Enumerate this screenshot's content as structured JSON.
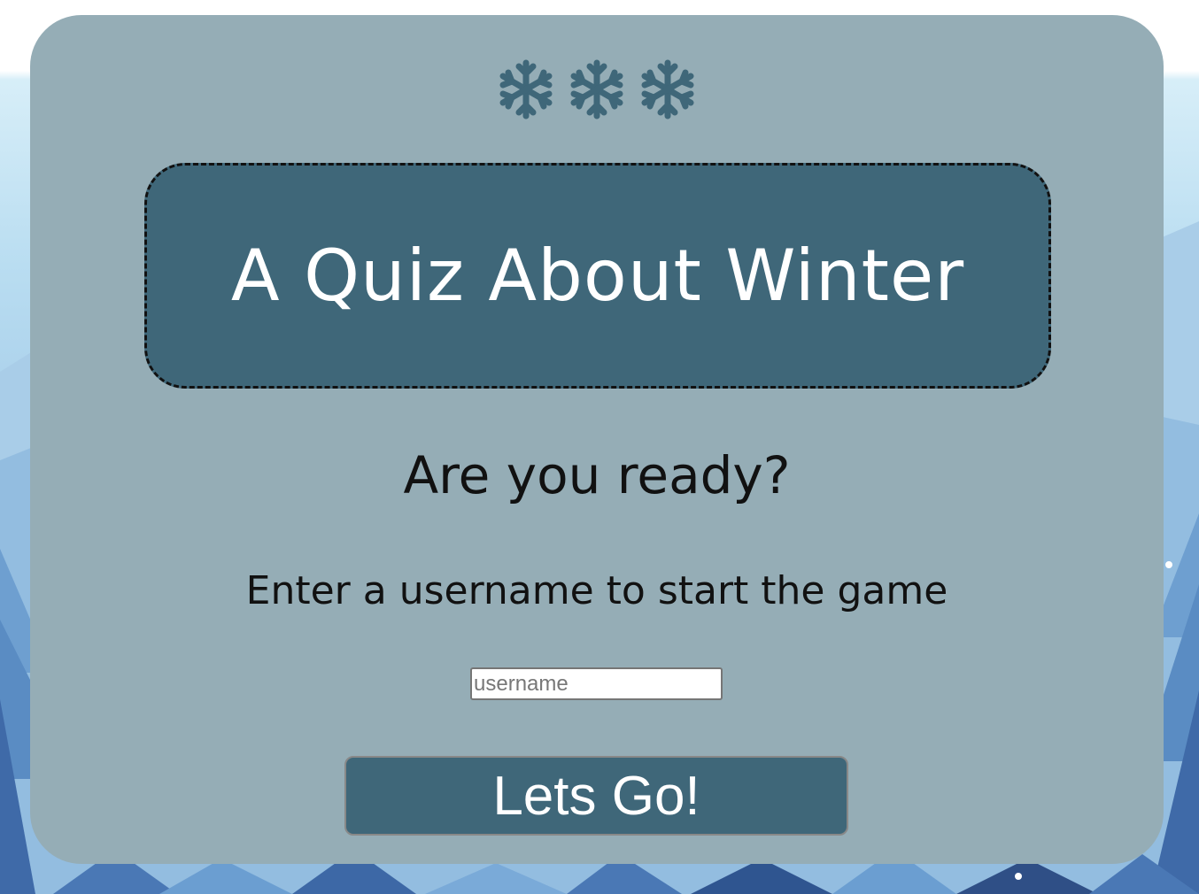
{
  "snowflakes": [
    "snowflake-icon",
    "snowflake-icon",
    "snowflake-icon"
  ],
  "title": "A Quiz About Winter",
  "subtitle": "Are you ready?",
  "instructions": "Enter a username to start the game",
  "username_input": {
    "placeholder": "username",
    "value": ""
  },
  "start_button": {
    "label": "Lets Go!"
  },
  "colors": {
    "card_background": "#95adb6",
    "accent": "#3f6779",
    "title_text": "#ffffff",
    "body_text": "#111111"
  }
}
